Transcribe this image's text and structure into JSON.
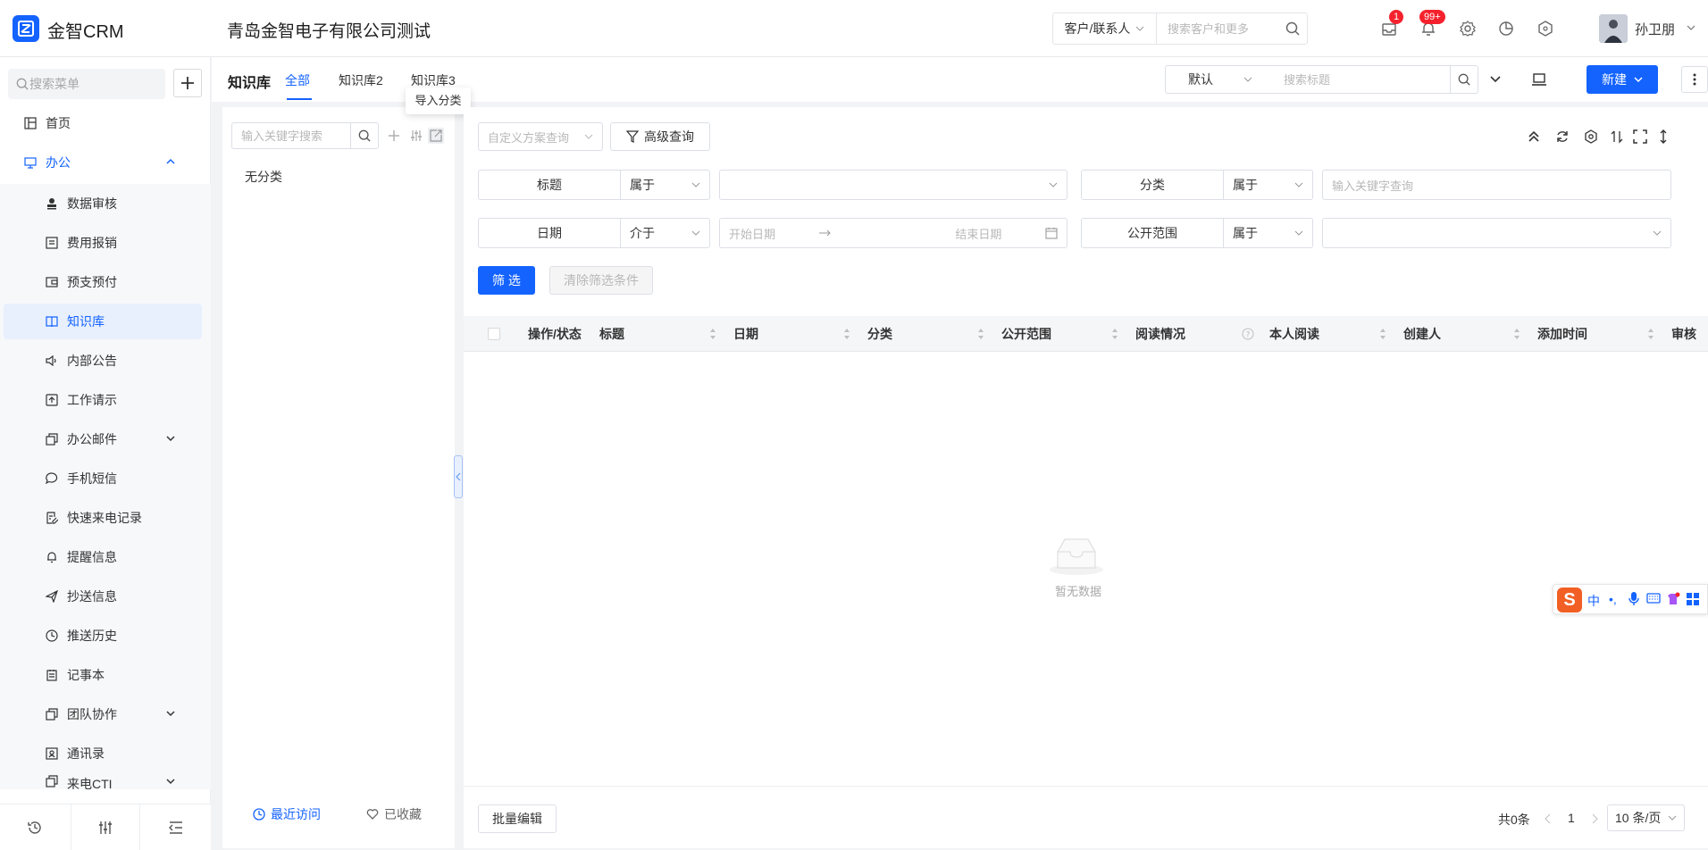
{
  "header": {
    "app_name": "金智CRM",
    "company": "青岛金智电子有限公司测试",
    "search_scope": "客户/联系人",
    "search_placeholder": "搜索客户和更多",
    "mail_badge": "1",
    "notice_badge": "99+",
    "user_name": "孙卫朋",
    "brand_color": "#1463ff"
  },
  "sidebar": {
    "search_placeholder": "搜索菜单",
    "items": [
      {
        "label": "首页",
        "icon": "dashboard-icon"
      },
      {
        "label": "办公",
        "icon": "monitor-icon",
        "expanded": true
      },
      {
        "label": "数据审核",
        "icon": "stamp-icon"
      },
      {
        "label": "费用报销",
        "icon": "receipt-icon"
      },
      {
        "label": "预支预付",
        "icon": "wallet-icon"
      },
      {
        "label": "知识库",
        "icon": "book-icon",
        "active": true
      },
      {
        "label": "内部公告",
        "icon": "speaker-icon"
      },
      {
        "label": "工作请示",
        "icon": "upload-doc-icon"
      },
      {
        "label": "办公邮件",
        "icon": "copy-icon",
        "has_children": true
      },
      {
        "label": "手机短信",
        "icon": "chat-icon"
      },
      {
        "label": "快速来电记录",
        "icon": "doc-edit-icon"
      },
      {
        "label": "提醒信息",
        "icon": "bell-icon"
      },
      {
        "label": "抄送信息",
        "icon": "send-icon"
      },
      {
        "label": "推送历史",
        "icon": "clock-icon"
      },
      {
        "label": "记事本",
        "icon": "notepad-icon"
      },
      {
        "label": "团队协作",
        "icon": "copy-icon",
        "has_children": true
      },
      {
        "label": "通讯录",
        "icon": "contacts-icon"
      },
      {
        "label": "来电CTI",
        "icon": "copy-icon",
        "has_children": true
      }
    ]
  },
  "content": {
    "page_title": "知识库",
    "tabs": [
      "全部",
      "知识库2",
      "知识库3"
    ],
    "view_select": "默认",
    "title_search_placeholder": "搜索标题",
    "new_button": "新建"
  },
  "categories": {
    "search_placeholder": "输入关键字搜索",
    "tooltip": "导入分类",
    "items": [
      "无分类"
    ],
    "recent": "最近访问",
    "favorites": "已收藏"
  },
  "list": {
    "scheme_placeholder": "自定义方案查询",
    "advanced_query": "高级查询",
    "filters": {
      "title_label": "标题",
      "title_op": "属于",
      "category_label": "分类",
      "category_op": "属于",
      "category_placeholder": "输入关键字查询",
      "date_label": "日期",
      "date_op": "介于",
      "date_start_placeholder": "开始日期",
      "date_end_placeholder": "结束日期",
      "scope_label": "公开范围",
      "scope_op": "属于"
    },
    "filter_button": "筛 选",
    "clear_button": "清除筛选条件",
    "columns": [
      "操作/状态",
      "标题",
      "日期",
      "分类",
      "公开范围",
      "阅读情况",
      "本人阅读",
      "创建人",
      "添加时间",
      "审核"
    ],
    "empty_text": "暂无数据",
    "batch_edit": "批量编辑",
    "total": "共0条",
    "page": "1",
    "page_size": "10 条/页"
  },
  "ime": {
    "logo": "S",
    "mode": "中",
    "punct": "•,"
  }
}
